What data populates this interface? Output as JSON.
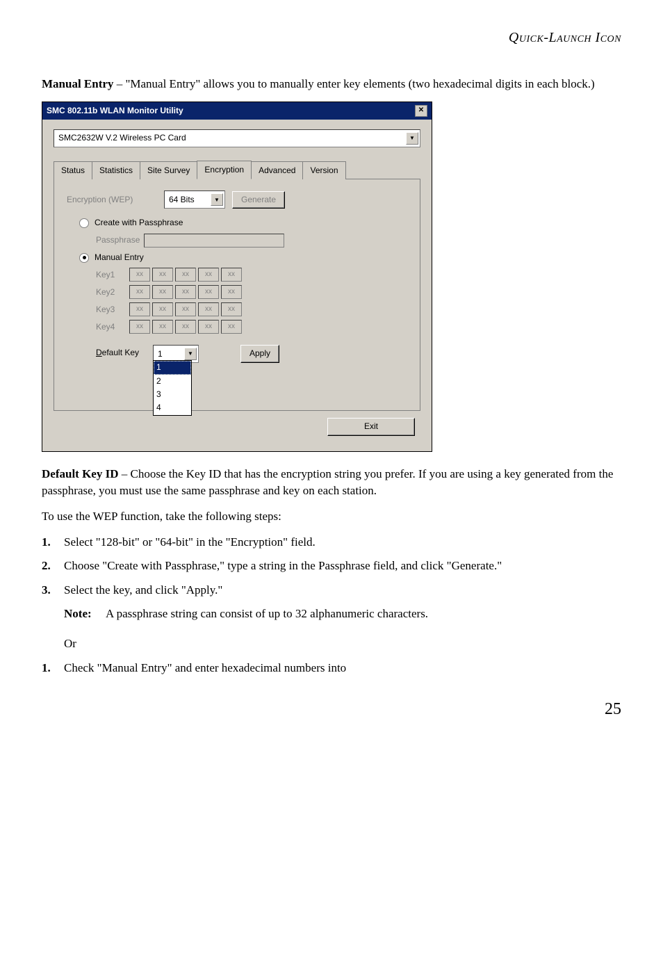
{
  "header": "Quick-Launch Icon",
  "intro": {
    "label": "Manual Entry",
    "text": " – \"Manual Entry\" allows you to manually enter key elements (two hexadecimal digits in each block.)"
  },
  "dialog": {
    "title": "SMC 802.11b WLAN Monitor Utility",
    "card": "SMC2632W V.2 Wireless PC Card",
    "tabs": [
      "Status",
      "Statistics",
      "Site Survey",
      "Encryption",
      "Advanced",
      "Version"
    ],
    "enc_label": "Encryption (WEP)",
    "enc_value": "64 Bits",
    "generate": "Generate",
    "mode_pass": "Create with Passphrase",
    "passphrase_label": "Passphrase",
    "mode_manual": "Manual Entry",
    "keys": [
      "Key1",
      "Key2",
      "Key3",
      "Key4"
    ],
    "key_cell": "xx",
    "default_key_label": "Default Key",
    "default_key_value": "1",
    "dropdown_options": [
      "1",
      "2",
      "3",
      "4"
    ],
    "apply": "Apply",
    "exit": "Exit"
  },
  "defkey_para": {
    "label": "Default Key ID",
    "text": " – Choose the Key ID that has the encryption string you prefer. If you are using a key generated from the passphrase, you must use the same passphrase and key on each station."
  },
  "wep_intro": "To use the WEP function, take the following steps:",
  "steps": [
    {
      "n": "1.",
      "t": "Select \"128-bit\" or \"64-bit\" in the \"Encryption\" field."
    },
    {
      "n": "2.",
      "t": "Choose \"Create with Passphrase,\" type a string in the Passphrase field, and click \"Generate.\""
    },
    {
      "n": "3.",
      "t": "Select the key, and click \"Apply.\""
    }
  ],
  "note": {
    "label": "Note:",
    "text": "A passphrase string can consist of up to 32 alphanumeric characters."
  },
  "or": "Or",
  "steps2": [
    {
      "n": "1.",
      "t": "Check \"Manual Entry\" and enter hexadecimal numbers into"
    }
  ],
  "pagenum": "25"
}
